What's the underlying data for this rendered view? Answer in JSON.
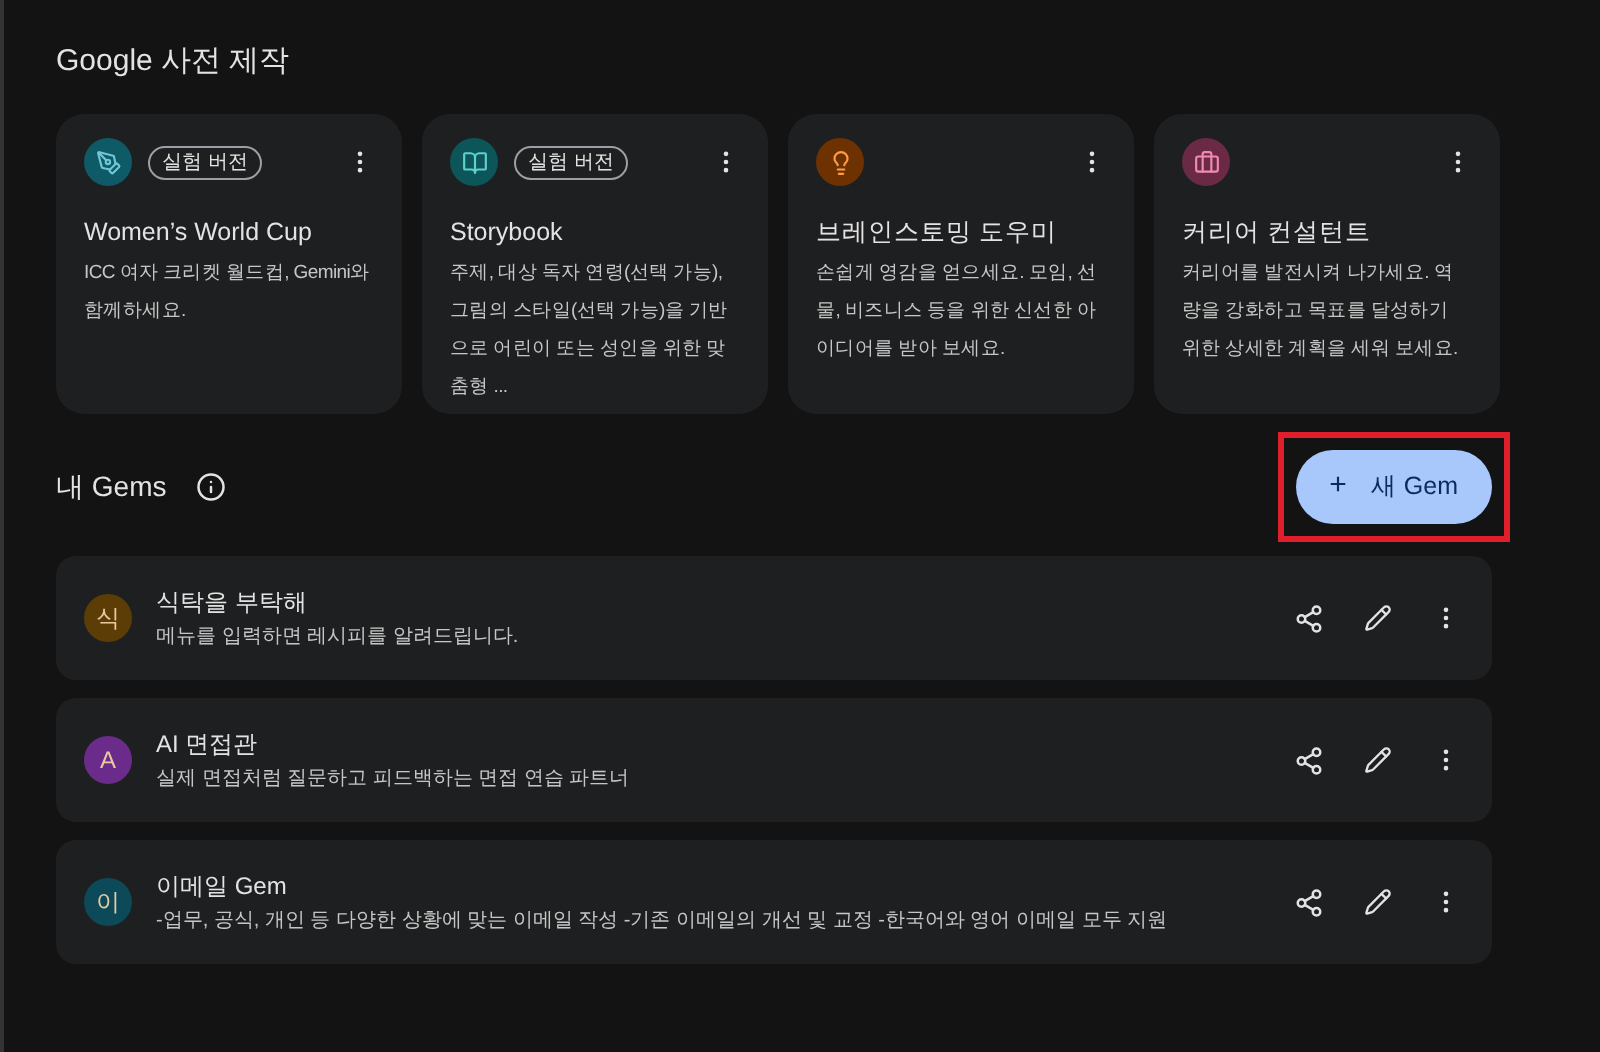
{
  "premade": {
    "title": "Google 사전 제작",
    "cards": [
      {
        "kind": "pen",
        "color": "#0e5a66",
        "badge": "실험 버전",
        "title": "Women’s World Cup",
        "description": "ICC 여자 크리켓 월드컵, Gemini와 함께하세요."
      },
      {
        "kind": "book",
        "color": "#0c5558",
        "badge": "실험 버전",
        "title": "Storybook",
        "description": "주제, 대상 독자 연령(선택 가능), 그림의 스타일(선택 가능)을 기반으로 어린이 또는 성인을 위한 맞춤형 ..."
      },
      {
        "kind": "bulb",
        "color": "#6e3200",
        "title": "브레인스토밍 도우미",
        "description": "손쉽게 영감을 얻으세요. 모임, 선물, 비즈니스 등을 위한 신선한 아이디어를 받아 보세요."
      },
      {
        "kind": "briefcase",
        "color": "#6a2a45",
        "title": "커리어 컨설턴트",
        "description": "커리어를 발전시켜 나가세요. 역량을 강화하고 목표를 달성하기 위한 상세한 계획을 세워 보세요."
      }
    ]
  },
  "my_gems": {
    "title": "내 Gems",
    "new_button": {
      "icon": "+",
      "label": "새 Gem",
      "highlighted": true
    },
    "items": [
      {
        "initial": "식",
        "color": "#5c3d05",
        "name": "식탁을 부탁해",
        "description": "메뉴를 입력하면 레시피를 알려드립니다."
      },
      {
        "initial": "A",
        "color": "#6a2b8a",
        "name": "AI 면접관",
        "description": "실제 면접처럼 질문하고 피드백하는 면접 연습 파트너"
      },
      {
        "initial": "이",
        "color": "#0c4a5a",
        "name": "이메일 Gem",
        "description": "-업무, 공식, 개인 등 다양한 상황에 맞는 이메일 작성 -기존 이메일의 개선 및 교정 -한국어와 영어 이메일 모두 지원"
      }
    ]
  }
}
